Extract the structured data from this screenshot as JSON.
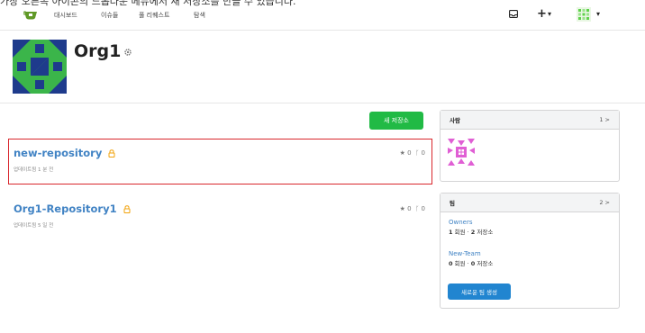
{
  "banner": {
    "text": "가장 오른쪽 아이콘의 드롭다운 메뉴에서 새 저장소를 만들 수 있습니다."
  },
  "nav": {
    "logo": "gitea-logo",
    "links": [
      "대시보드",
      "이슈들",
      "풀 리퀘스트",
      "탐색"
    ],
    "icons": {
      "notifications": "inbox-icon",
      "create": "+",
      "create_caret": "▾",
      "profile_caret": "▾"
    }
  },
  "org": {
    "name": "Org1",
    "avatar": "org-identicon",
    "settings_icon": "gear-icon"
  },
  "actions": {
    "new_repo_label": "새 저장소"
  },
  "repos": [
    {
      "name": "new-repository",
      "private": true,
      "updated": "업데이트됨 1 분 전",
      "stars": "0",
      "forks": "0"
    },
    {
      "name": "Org1-Repository1",
      "private": true,
      "updated": "업데이트됨 5 일 전",
      "stars": "0",
      "forks": "0"
    }
  ],
  "people": {
    "title": "사람",
    "count": "1",
    "chevron": ">"
  },
  "teams": {
    "title": "팀",
    "count": "2",
    "chevron": ">",
    "items": [
      {
        "name": "Owners",
        "members": "1",
        "members_label": "회원",
        "repos": "2",
        "repos_label": "저장소"
      },
      {
        "name": "New-Team",
        "members": "0",
        "members_label": "회원",
        "repos": "0",
        "repos_label": "저장소"
      }
    ],
    "create_label": "새로운 팀 생성"
  },
  "colors": {
    "accent_green": "#21ba45",
    "link_blue": "#4183c4",
    "button_blue": "#2185d0",
    "lock_orange": "#f2a30c",
    "highlight_red": "#d9262c",
    "org_avatar_green": "#3bb54a",
    "org_avatar_navy": "#1e3b8c"
  }
}
